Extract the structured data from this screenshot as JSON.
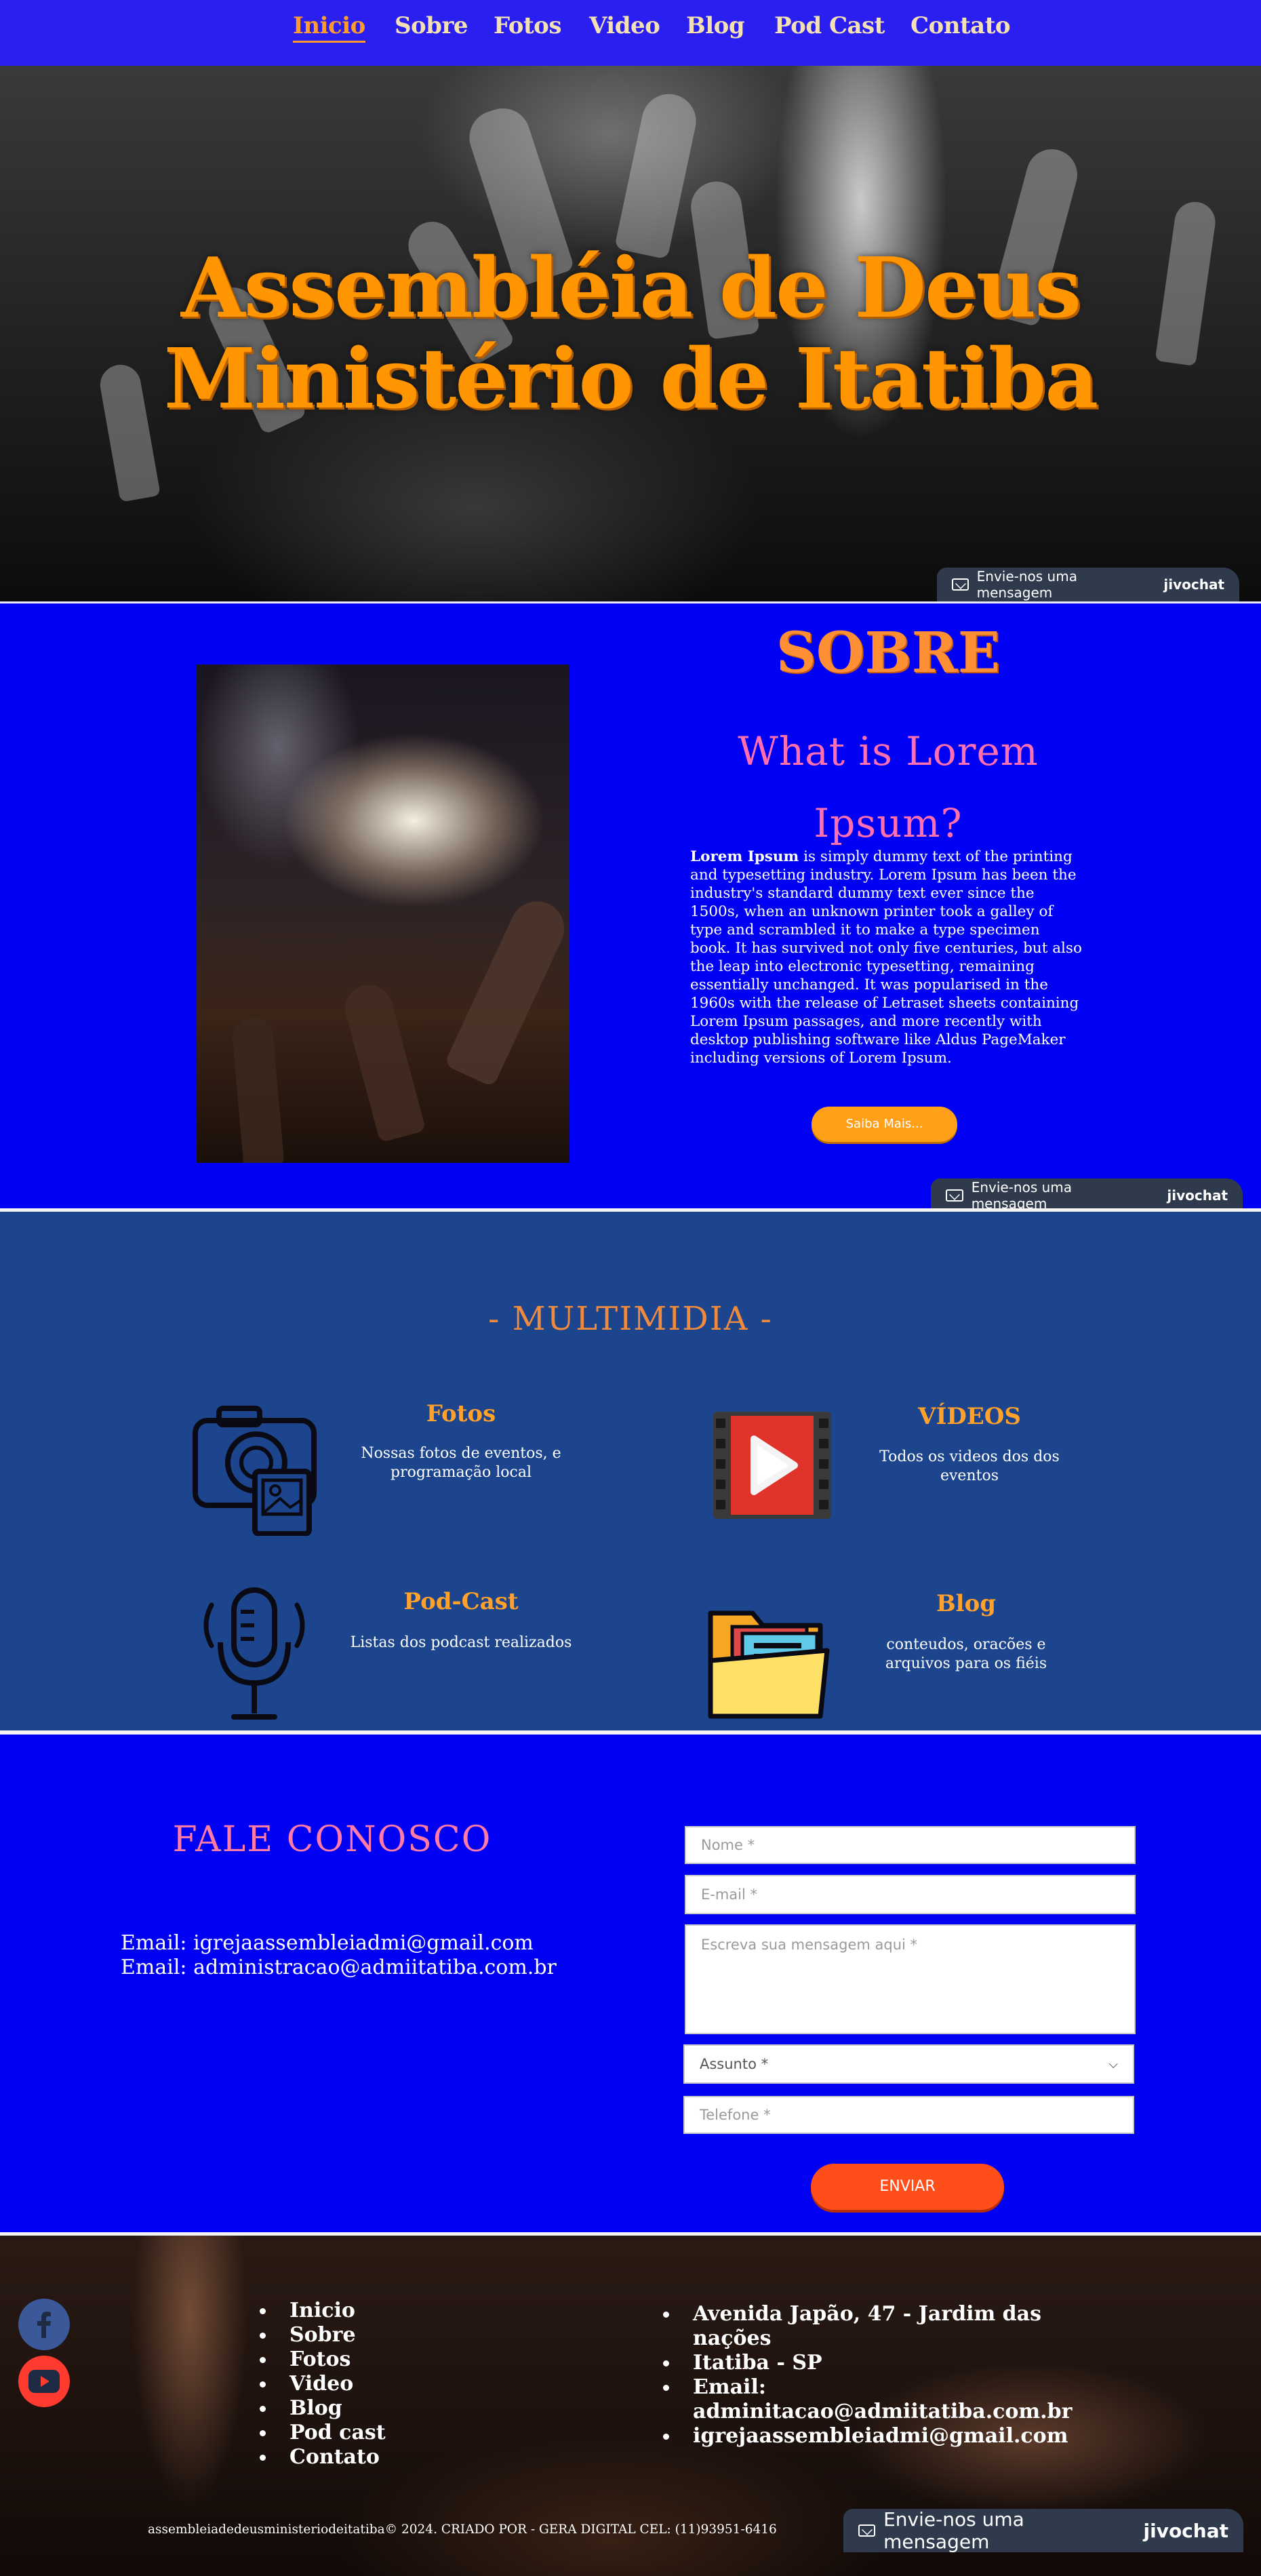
{
  "nav": {
    "items": [
      "Inicio",
      "Sobre",
      "Fotos",
      "Video",
      "Blog",
      "Pod Cast",
      "Contato"
    ]
  },
  "hero": {
    "title_line1": "Assembléia de Deus",
    "title_line2": "Ministério de Itatiba"
  },
  "chat": {
    "label": "Envie-nos uma mensagem",
    "brand": "jivochat"
  },
  "sobre": {
    "title": "SOBRE",
    "subtitle_line1": "What is Lorem",
    "subtitle_line2": "Ipsum?",
    "text_bold": "Lorem Ipsum",
    "text_rest": " is simply dummy text of the printing and typesetting industry. Lorem Ipsum has been the industry's standard dummy text ever since the 1500s, when an unknown printer took a galley of type and scrambled it to make a type specimen book. It has survived not only five centuries, but also the leap into electronic typesetting, remaining essentially unchanged. It was popularised in the 1960s with the release of Letraset sheets containing Lorem Ipsum passages, and more recently with desktop publishing software like Aldus PageMaker including versions of Lorem Ipsum.",
    "button": "Saiba Mais..."
  },
  "multimidia": {
    "title": "- MULTIMIDIA -",
    "cards": [
      {
        "title": "Fotos",
        "text": "Nossas fotos de eventos, e programação local",
        "icon": "camera-photo-icon"
      },
      {
        "title": "VÍDEOS",
        "text": "Todos os videos dos dos eventos",
        "icon": "video-play-icon"
      },
      {
        "title": "Pod-Cast",
        "text": "Listas dos podcast realizados",
        "icon": "microphone-icon"
      },
      {
        "title": "Blog",
        "text": "conteudos, oracões e arquivos para os fiéis",
        "icon": "folder-icon"
      }
    ]
  },
  "contact": {
    "title": "FALE CONOSCO",
    "email1": "Email: igrejaassembleiadmi@gmail.com",
    "email2": "Email:  administracao@admiitatiba.com.br",
    "placeholders": {
      "name": "Nome *",
      "email": "E-mail *",
      "message": "Escreva sua mensagem aqui *",
      "subject": "Assunto *",
      "phone": "Telefone *"
    },
    "submit": "ENVIAR"
  },
  "footer": {
    "links": [
      "Inicio",
      "Sobre",
      "Fotos",
      "Video",
      "Blog",
      "Pod cast",
      "Contato"
    ],
    "address": [
      "Avenida Japão, 47 - Jardim das nações",
      "Itatiba - SP",
      "Email: adminitacao@admiitatiba.com.br",
      "igrejaassembleiadmi@gmail.com"
    ],
    "copyright": "assembleiadedeusministeriodeitatiba© 2024. CRIADO POR - GERA DIGITAL CEL: (11)93951-6416"
  },
  "colors": {
    "nav_bg": "#2a1ff0",
    "accent_orange": "#ff9500",
    "section_blue": "#0000f5",
    "multimidia_bg": "#1c458d",
    "submit_btn": "#ff4e1a"
  }
}
